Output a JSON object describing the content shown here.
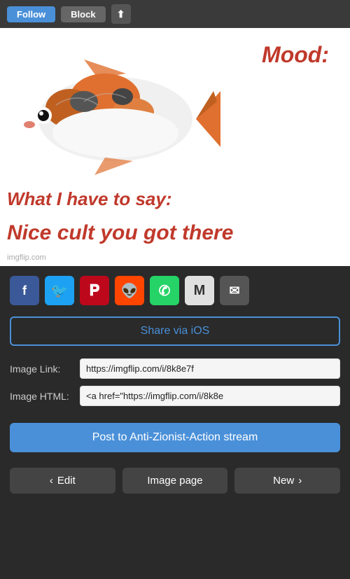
{
  "topbar": {
    "follow_label": "Follow",
    "block_label": "Block",
    "share_icon": "⬆"
  },
  "meme": {
    "mood_text": "Mood:",
    "say_text": "What I have to say:",
    "cult_text": "Nice cult you got there",
    "watermark": "imgflip.com"
  },
  "social": {
    "facebook_icon": "f",
    "twitter_icon": "𝕥",
    "pinterest_icon": "𝐩",
    "reddit_icon": "𝐫",
    "whatsapp_icon": "✆",
    "gmail_icon": "M",
    "email_icon": "✉",
    "share_ios_label": "Share via iOS"
  },
  "fields": {
    "image_link_label": "Image Link:",
    "image_html_label": "Image HTML:",
    "image_link_value": "https://imgflip.com/i/8k8e7f",
    "image_html_value": "<a href=\"https://imgflip.com/i/8k8e"
  },
  "actions": {
    "post_stream_label": "Post to Anti-Zionist-Action stream"
  },
  "nav": {
    "edit_label": "Edit",
    "edit_icon": "‹",
    "image_page_label": "Image page",
    "new_label": "New",
    "new_icon": "›"
  }
}
